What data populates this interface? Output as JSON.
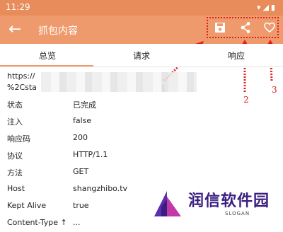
{
  "status_bar": {
    "time": "11:29"
  },
  "toolbar": {
    "title": "抓包内容",
    "icons": [
      "arrow-back-icon",
      "save-icon",
      "share-icon",
      "heart-icon"
    ]
  },
  "annotations": [
    "1",
    "2",
    "3"
  ],
  "tabs": [
    {
      "label": "总览",
      "active": true
    },
    {
      "label": "请求"
    },
    {
      "label": "响应"
    }
  ],
  "url": {
    "line1": "https://",
    "line2": "%2Csta"
  },
  "details": [
    {
      "key": "状态",
      "value": "已完成"
    },
    {
      "key": "注入",
      "value": "false"
    },
    {
      "key": "响应码",
      "value": "200"
    },
    {
      "key": "协议",
      "value": "HTTP/1.1"
    },
    {
      "key": "方法",
      "value": "GET"
    },
    {
      "key": "Host",
      "value": "shangzhibo.tv"
    },
    {
      "key": "Kept Alive",
      "value": "true"
    },
    {
      "key": "Content-Type ↑",
      "value": "..."
    }
  ],
  "watermark": {
    "text": "润信软件园",
    "slogan": "SLOGAN"
  },
  "colors": {
    "accent": "#ee9a6c",
    "status_bar": "#e78c5a",
    "annotation": "#e02020"
  }
}
